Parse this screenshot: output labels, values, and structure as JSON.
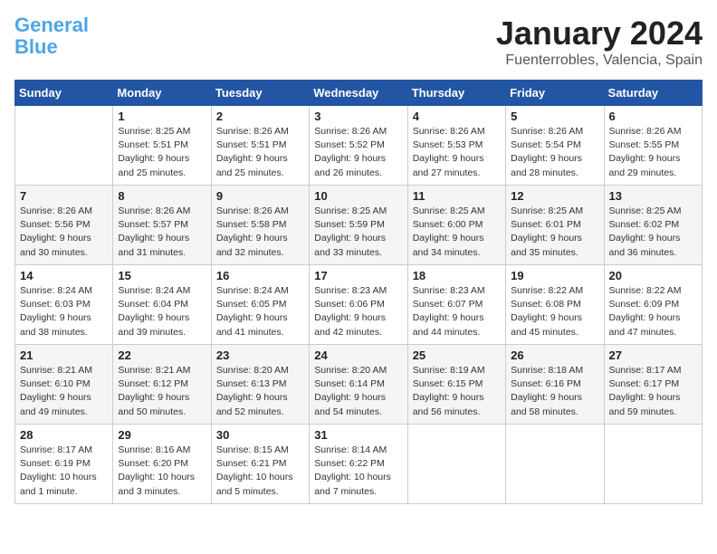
{
  "header": {
    "logo_general": "General",
    "logo_blue": "Blue",
    "month_title": "January 2024",
    "location": "Fuenterrobles, Valencia, Spain"
  },
  "days_of_week": [
    "Sunday",
    "Monday",
    "Tuesday",
    "Wednesday",
    "Thursday",
    "Friday",
    "Saturday"
  ],
  "weeks": [
    [
      {
        "day": "",
        "info": ""
      },
      {
        "day": "1",
        "info": "Sunrise: 8:25 AM\nSunset: 5:51 PM\nDaylight: 9 hours\nand 25 minutes."
      },
      {
        "day": "2",
        "info": "Sunrise: 8:26 AM\nSunset: 5:51 PM\nDaylight: 9 hours\nand 25 minutes."
      },
      {
        "day": "3",
        "info": "Sunrise: 8:26 AM\nSunset: 5:52 PM\nDaylight: 9 hours\nand 26 minutes."
      },
      {
        "day": "4",
        "info": "Sunrise: 8:26 AM\nSunset: 5:53 PM\nDaylight: 9 hours\nand 27 minutes."
      },
      {
        "day": "5",
        "info": "Sunrise: 8:26 AM\nSunset: 5:54 PM\nDaylight: 9 hours\nand 28 minutes."
      },
      {
        "day": "6",
        "info": "Sunrise: 8:26 AM\nSunset: 5:55 PM\nDaylight: 9 hours\nand 29 minutes."
      }
    ],
    [
      {
        "day": "7",
        "info": "Sunrise: 8:26 AM\nSunset: 5:56 PM\nDaylight: 9 hours\nand 30 minutes."
      },
      {
        "day": "8",
        "info": "Sunrise: 8:26 AM\nSunset: 5:57 PM\nDaylight: 9 hours\nand 31 minutes."
      },
      {
        "day": "9",
        "info": "Sunrise: 8:26 AM\nSunset: 5:58 PM\nDaylight: 9 hours\nand 32 minutes."
      },
      {
        "day": "10",
        "info": "Sunrise: 8:25 AM\nSunset: 5:59 PM\nDaylight: 9 hours\nand 33 minutes."
      },
      {
        "day": "11",
        "info": "Sunrise: 8:25 AM\nSunset: 6:00 PM\nDaylight: 9 hours\nand 34 minutes."
      },
      {
        "day": "12",
        "info": "Sunrise: 8:25 AM\nSunset: 6:01 PM\nDaylight: 9 hours\nand 35 minutes."
      },
      {
        "day": "13",
        "info": "Sunrise: 8:25 AM\nSunset: 6:02 PM\nDaylight: 9 hours\nand 36 minutes."
      }
    ],
    [
      {
        "day": "14",
        "info": "Sunrise: 8:24 AM\nSunset: 6:03 PM\nDaylight: 9 hours\nand 38 minutes."
      },
      {
        "day": "15",
        "info": "Sunrise: 8:24 AM\nSunset: 6:04 PM\nDaylight: 9 hours\nand 39 minutes."
      },
      {
        "day": "16",
        "info": "Sunrise: 8:24 AM\nSunset: 6:05 PM\nDaylight: 9 hours\nand 41 minutes."
      },
      {
        "day": "17",
        "info": "Sunrise: 8:23 AM\nSunset: 6:06 PM\nDaylight: 9 hours\nand 42 minutes."
      },
      {
        "day": "18",
        "info": "Sunrise: 8:23 AM\nSunset: 6:07 PM\nDaylight: 9 hours\nand 44 minutes."
      },
      {
        "day": "19",
        "info": "Sunrise: 8:22 AM\nSunset: 6:08 PM\nDaylight: 9 hours\nand 45 minutes."
      },
      {
        "day": "20",
        "info": "Sunrise: 8:22 AM\nSunset: 6:09 PM\nDaylight: 9 hours\nand 47 minutes."
      }
    ],
    [
      {
        "day": "21",
        "info": "Sunrise: 8:21 AM\nSunset: 6:10 PM\nDaylight: 9 hours\nand 49 minutes."
      },
      {
        "day": "22",
        "info": "Sunrise: 8:21 AM\nSunset: 6:12 PM\nDaylight: 9 hours\nand 50 minutes."
      },
      {
        "day": "23",
        "info": "Sunrise: 8:20 AM\nSunset: 6:13 PM\nDaylight: 9 hours\nand 52 minutes."
      },
      {
        "day": "24",
        "info": "Sunrise: 8:20 AM\nSunset: 6:14 PM\nDaylight: 9 hours\nand 54 minutes."
      },
      {
        "day": "25",
        "info": "Sunrise: 8:19 AM\nSunset: 6:15 PM\nDaylight: 9 hours\nand 56 minutes."
      },
      {
        "day": "26",
        "info": "Sunrise: 8:18 AM\nSunset: 6:16 PM\nDaylight: 9 hours\nand 58 minutes."
      },
      {
        "day": "27",
        "info": "Sunrise: 8:17 AM\nSunset: 6:17 PM\nDaylight: 9 hours\nand 59 minutes."
      }
    ],
    [
      {
        "day": "28",
        "info": "Sunrise: 8:17 AM\nSunset: 6:19 PM\nDaylight: 10 hours\nand 1 minute."
      },
      {
        "day": "29",
        "info": "Sunrise: 8:16 AM\nSunset: 6:20 PM\nDaylight: 10 hours\nand 3 minutes."
      },
      {
        "day": "30",
        "info": "Sunrise: 8:15 AM\nSunset: 6:21 PM\nDaylight: 10 hours\nand 5 minutes."
      },
      {
        "day": "31",
        "info": "Sunrise: 8:14 AM\nSunset: 6:22 PM\nDaylight: 10 hours\nand 7 minutes."
      },
      {
        "day": "",
        "info": ""
      },
      {
        "day": "",
        "info": ""
      },
      {
        "day": "",
        "info": ""
      }
    ]
  ]
}
